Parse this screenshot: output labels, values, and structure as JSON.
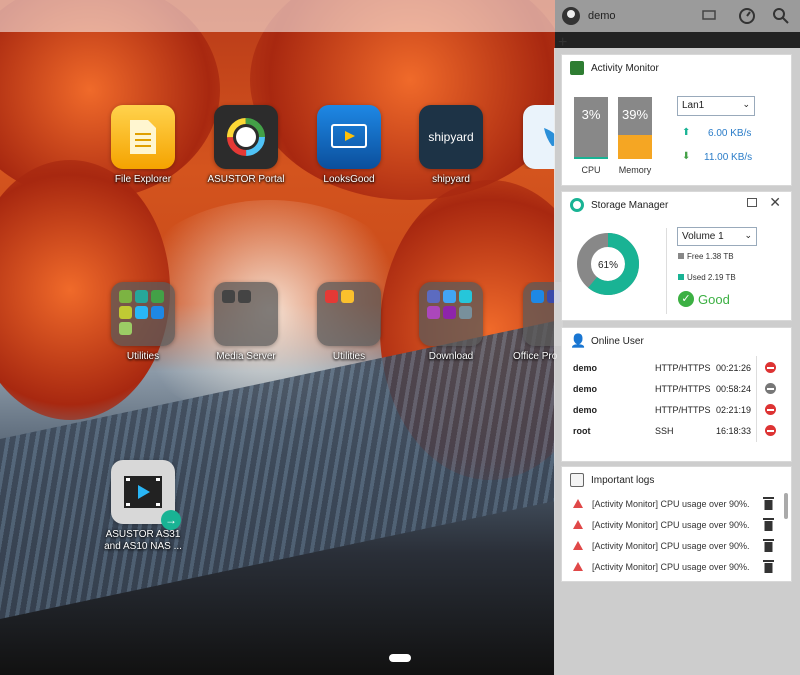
{
  "topbar": {
    "username": "demo"
  },
  "desktop": {
    "apps": [
      {
        "label": "File Explorer"
      },
      {
        "label": "ASUSTOR Portal"
      },
      {
        "label": "LooksGood"
      },
      {
        "label": "shipyard",
        "icon_text": "shipyard"
      },
      {
        "label": ""
      }
    ],
    "folders": [
      {
        "label": "Utilities"
      },
      {
        "label": "Media Server"
      },
      {
        "label": "Utilities"
      },
      {
        "label": "Download"
      },
      {
        "label": "Office Pro"
      }
    ],
    "video": {
      "label_line1": "ASUSTOR AS31",
      "label_line2": "and AS10 NAS ..."
    }
  },
  "activity_monitor": {
    "title": "Activity Monitor",
    "cpu": {
      "label": "CPU",
      "value": "3%",
      "percent": 3
    },
    "memory": {
      "label": "Memory",
      "value": "39%",
      "percent": 39
    },
    "interface": "Lan1",
    "upload": "6.00 KB/s",
    "download": "11.00 KB/s"
  },
  "storage_manager": {
    "title": "Storage Manager",
    "used_percent": 61,
    "used_label": "61%",
    "volume": "Volume 1",
    "free": "Free 1.38 TB",
    "used": "Used 2.19 TB",
    "status": "Good"
  },
  "online_user": {
    "title": "Online User",
    "rows": [
      {
        "user": "demo",
        "protocol": "HTTP/HTTPS",
        "time": "00:21:26"
      },
      {
        "user": "demo",
        "protocol": "HTTP/HTTPS",
        "time": "00:58:24"
      },
      {
        "user": "demo",
        "protocol": "HTTP/HTTPS",
        "time": "02:21:19"
      },
      {
        "user": "root",
        "protocol": "SSH",
        "time": "16:18:33"
      }
    ]
  },
  "important_logs": {
    "title": "Important logs",
    "entries": [
      {
        "text": "[Activity Monitor] CPU usage over 90%."
      },
      {
        "text": "[Activity Monitor] CPU usage over 90%."
      },
      {
        "text": "[Activity Monitor] CPU usage over 90%."
      },
      {
        "text": "[Activity Monitor] CPU usage over 90%."
      }
    ]
  },
  "colors": {
    "storage_used": "#19b394",
    "storage_free": "#888888",
    "memory": "#f5a623",
    "cpu": "#19b394",
    "good": "#3cb043"
  }
}
